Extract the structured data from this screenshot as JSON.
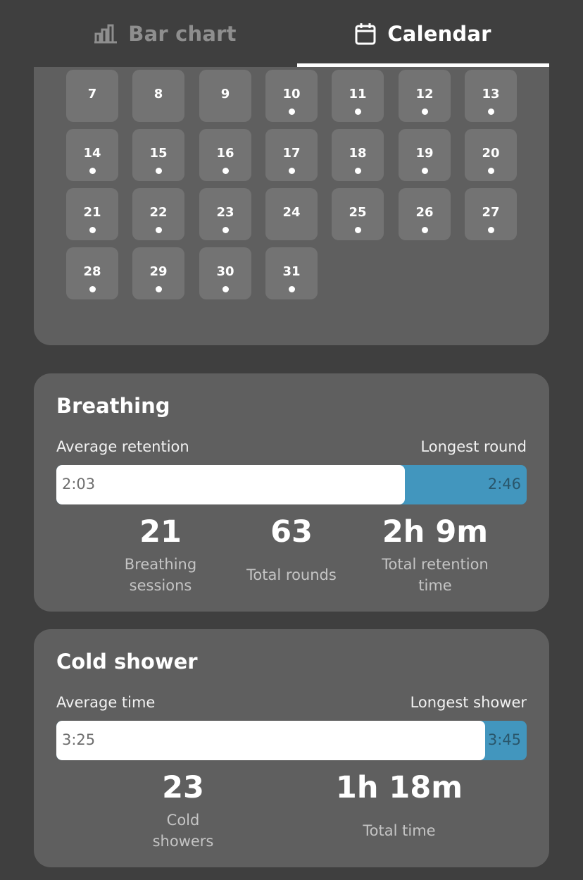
{
  "tabs": {
    "bar_chart": {
      "label": "Bar chart",
      "icon": "bar-chart-icon"
    },
    "calendar": {
      "label": "Calendar",
      "icon": "calendar-icon",
      "selected": true
    }
  },
  "calendar": {
    "days": [
      {
        "label": "7",
        "marked": false
      },
      {
        "label": "8",
        "marked": false
      },
      {
        "label": "9",
        "marked": false
      },
      {
        "label": "10",
        "marked": true
      },
      {
        "label": "11",
        "marked": true
      },
      {
        "label": "12",
        "marked": true
      },
      {
        "label": "13",
        "marked": true
      },
      {
        "label": "14",
        "marked": true
      },
      {
        "label": "15",
        "marked": true
      },
      {
        "label": "16",
        "marked": true
      },
      {
        "label": "17",
        "marked": true
      },
      {
        "label": "18",
        "marked": true
      },
      {
        "label": "19",
        "marked": true
      },
      {
        "label": "20",
        "marked": true
      },
      {
        "label": "21",
        "marked": true
      },
      {
        "label": "22",
        "marked": true
      },
      {
        "label": "23",
        "marked": true
      },
      {
        "label": "24",
        "marked": false
      },
      {
        "label": "25",
        "marked": true
      },
      {
        "label": "26",
        "marked": true
      },
      {
        "label": "27",
        "marked": true
      },
      {
        "label": "28",
        "marked": true
      },
      {
        "label": "29",
        "marked": true
      },
      {
        "label": "30",
        "marked": true
      },
      {
        "label": "31",
        "marked": true
      }
    ]
  },
  "breathing": {
    "title": "Breathing",
    "left_label": "Average retention",
    "right_label": "Longest round",
    "average_value": "2:03",
    "longest_value": "2:46",
    "average_fraction": 0.741,
    "stats": [
      {
        "value": "21",
        "caption_lines": [
          "Breathing",
          "sessions"
        ]
      },
      {
        "value": "63",
        "caption_lines": [
          "Total rounds"
        ]
      },
      {
        "value": "2h 9m",
        "caption_lines": [
          "Total retention",
          "time"
        ]
      }
    ]
  },
  "cold_shower": {
    "title": "Cold shower",
    "left_label": "Average time",
    "right_label": "Longest shower",
    "average_value": "3:25",
    "longest_value": "3:45",
    "average_fraction": 0.911,
    "stats": [
      {
        "value": "23",
        "caption_lines": [
          "Cold",
          "showers"
        ]
      },
      {
        "value": "1h 18m",
        "caption_lines": [
          "Total time"
        ]
      }
    ]
  },
  "colors": {
    "background": "#3f3f3f",
    "card": "#5f5f5f",
    "day_tile": "#737373",
    "accent": "#4296be",
    "muted_tab": "#8e8e8e"
  }
}
